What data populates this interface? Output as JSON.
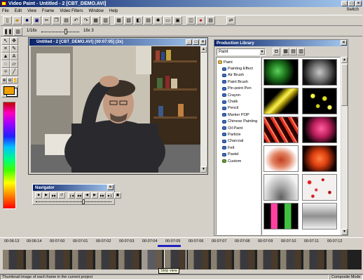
{
  "app": {
    "title": "Video Paint - Untitled - 2 [CBT_DEMO.AVI]",
    "menu": [
      "File",
      "Edit",
      "View",
      "Frame",
      "Video Filters",
      "Window",
      "Help"
    ],
    "switch_label": "Switch",
    "status_text": "Thumbnail image of each frame in the current project",
    "status_mode": "Composite Mode"
  },
  "zoom_bar": {
    "left_label": "1/16x",
    "right_label": "16x  3"
  },
  "video_window": {
    "title": "Untitled - 2 [CBT_DEMO.AVI] [00:07:05] (3x)"
  },
  "navigator": {
    "title": "Navigator",
    "buttons": [
      "■",
      "▶",
      "▶▶",
      "↺",
      "❙◀",
      "◀◀",
      "◀",
      "▶",
      "▶▶",
      "▶❙",
      "▣"
    ]
  },
  "library": {
    "title": "Production Library",
    "dropdown": "Paint",
    "root": "Paint",
    "items": [
      "Painting Effect",
      "Air Brush",
      "Paint Brush",
      "Pin-point Pen",
      "Crayon",
      "Chalk",
      "Pencil",
      "Marker POP",
      "Chinese Painting",
      "Oil Paint",
      "Particle",
      "Charcoal",
      "Felt",
      "Pastel",
      "Custom"
    ]
  },
  "timeline": {
    "timecodes": [
      "00:06:13",
      "00:06:14",
      "00:07:00",
      "00:07:01",
      "00:07:02",
      "00:07:03",
      "00:07:04",
      "00:07:05",
      "00:07:06",
      "00:07:07",
      "00:07:08",
      "00:07:09",
      "00:07:10",
      "00:07:11",
      "00:07:12"
    ],
    "tooltip": "Strip view"
  },
  "colors": {
    "accent_fg": "#f0a000",
    "accent_bg": "#ffffff",
    "titlebar": "#0a246a"
  }
}
